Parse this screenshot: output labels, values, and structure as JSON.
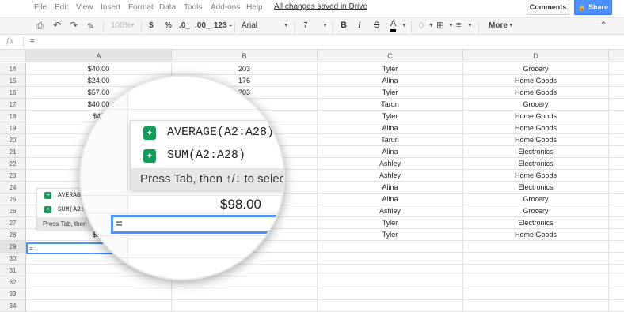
{
  "menu": {
    "items": [
      "File",
      "Edit",
      "View",
      "Insert",
      "Format",
      "Data",
      "Tools",
      "Add-ons",
      "Help"
    ],
    "saved_status": "All changes saved in Drive",
    "comments_label": "Comments",
    "share_label": "Share"
  },
  "toolbar": {
    "zoom": "100%",
    "currency": "$",
    "percent": "%",
    "dec_decrease": ".0_",
    "dec_increase": ".00_",
    "number_format": "123 -",
    "font": "Arial",
    "font_size": "7",
    "bold": "B",
    "italic": "I",
    "strike": "S",
    "text_color": "A",
    "more": "More"
  },
  "formula_bar": {
    "fx": "fx",
    "value": "="
  },
  "columns": [
    "A",
    "B",
    "C",
    "D"
  ],
  "rows": [
    {
      "num": "14",
      "a": "$40.00",
      "b": "203",
      "c": "Tyler",
      "d": "Grocery"
    },
    {
      "num": "15",
      "a": "$24.00",
      "b": "176",
      "c": "Alina",
      "d": "Home Goods"
    },
    {
      "num": "16",
      "a": "$57.00",
      "b": "203",
      "c": "Tyler",
      "d": "Home Goods"
    },
    {
      "num": "17",
      "a": "$40.00",
      "b": "",
      "c": "Tarun",
      "d": "Grocery"
    },
    {
      "num": "18",
      "a": "$45",
      "b": "",
      "c": "Tyler",
      "d": "Home Goods"
    },
    {
      "num": "19",
      "a": "$",
      "b": "",
      "c": "Alina",
      "d": "Home Goods"
    },
    {
      "num": "20",
      "a": "",
      "b": "",
      "c": "Tarun",
      "d": "Home Goods"
    },
    {
      "num": "21",
      "a": "",
      "b": "",
      "c": "Alina",
      "d": "Electronics"
    },
    {
      "num": "22",
      "a": "",
      "b": "",
      "c": "Ashley",
      "d": "Electronics"
    },
    {
      "num": "23",
      "a": "",
      "b": "",
      "c": "Ashley",
      "d": "Home Goods"
    },
    {
      "num": "24",
      "a": "",
      "b": "",
      "c": "Alina",
      "d": "Electronics"
    },
    {
      "num": "25",
      "a": "",
      "b": "",
      "c": "Alina",
      "d": "Grocery"
    },
    {
      "num": "26",
      "a": "",
      "b": "",
      "c": "Ashley",
      "d": "Grocery"
    },
    {
      "num": "27",
      "a": "",
      "b": "",
      "c": "Tyler",
      "d": "Electronics"
    },
    {
      "num": "28",
      "a": "$98",
      "b": "",
      "c": "Tyler",
      "d": "Home Goods"
    },
    {
      "num": "29",
      "a": "=",
      "b": "",
      "c": "",
      "d": ""
    },
    {
      "num": "30",
      "a": "",
      "b": "",
      "c": "",
      "d": ""
    },
    {
      "num": "31",
      "a": "",
      "b": "",
      "c": "",
      "d": ""
    },
    {
      "num": "32",
      "a": "",
      "b": "",
      "c": "",
      "d": ""
    },
    {
      "num": "33",
      "a": "",
      "b": "",
      "c": "",
      "d": ""
    },
    {
      "num": "34",
      "a": "",
      "b": "",
      "c": "",
      "d": ""
    }
  ],
  "suggestions_small": {
    "items": [
      "AVERAGE",
      "SUM(A2:A"
    ],
    "hint": "Press Tab, then"
  },
  "magnifier": {
    "suggestions": [
      "AVERAGE(A2:A28)",
      "SUM(A2:A28)"
    ],
    "hint": "Press Tab, then ↑/↓ to selec",
    "value": "$98.00",
    "active_cell": "="
  },
  "colors": {
    "accent": "#4d90fe",
    "suggest_icon": "#0f9d58"
  }
}
